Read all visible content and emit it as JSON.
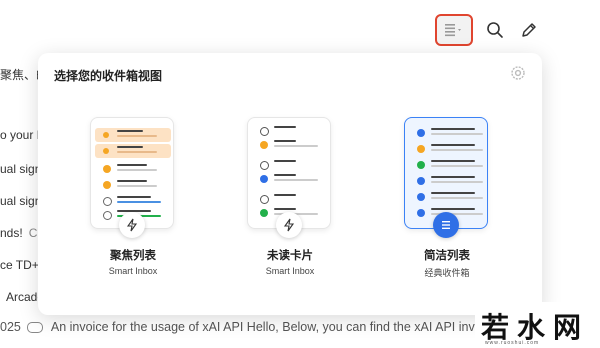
{
  "background_list": {
    "lines": [
      {
        "text": "聚焦、邮",
        "tag": ""
      },
      {
        "text": "o your I",
        "tag": ""
      },
      {
        "text": "ual sign",
        "tag": ""
      },
      {
        "text": "ual sign",
        "tag": ""
      },
      {
        "text": "nds!",
        "tag": "C"
      },
      {
        "text": "ce TD+",
        "tag": ""
      },
      {
        "text": "Arcade",
        "tag": ""
      }
    ],
    "bottom_row": {
      "date": "025",
      "preview": "An invoice for the usage of xAI API Hello, Below, you can find the xAI API invoic..."
    }
  },
  "toolbar": {
    "view_icon": "list-view-icon",
    "search_icon": "search-icon",
    "compose_icon": "pencil-icon"
  },
  "modal": {
    "title": "选择您的收件箱视图",
    "options": [
      {
        "label": "聚焦列表",
        "sub": "Smart Inbox",
        "selected": false
      },
      {
        "label": "未读卡片",
        "sub": "Smart Inbox",
        "selected": false
      },
      {
        "label": "简洁列表",
        "sub": "经典收件箱",
        "selected": true
      }
    ]
  },
  "watermark": {
    "text": "若水网",
    "small": "www.ruoshui.com"
  },
  "colors": {
    "accent": "#2f6fe6",
    "highlight": "#e0452f",
    "orange": "#f5a623",
    "green": "#22b04b"
  }
}
